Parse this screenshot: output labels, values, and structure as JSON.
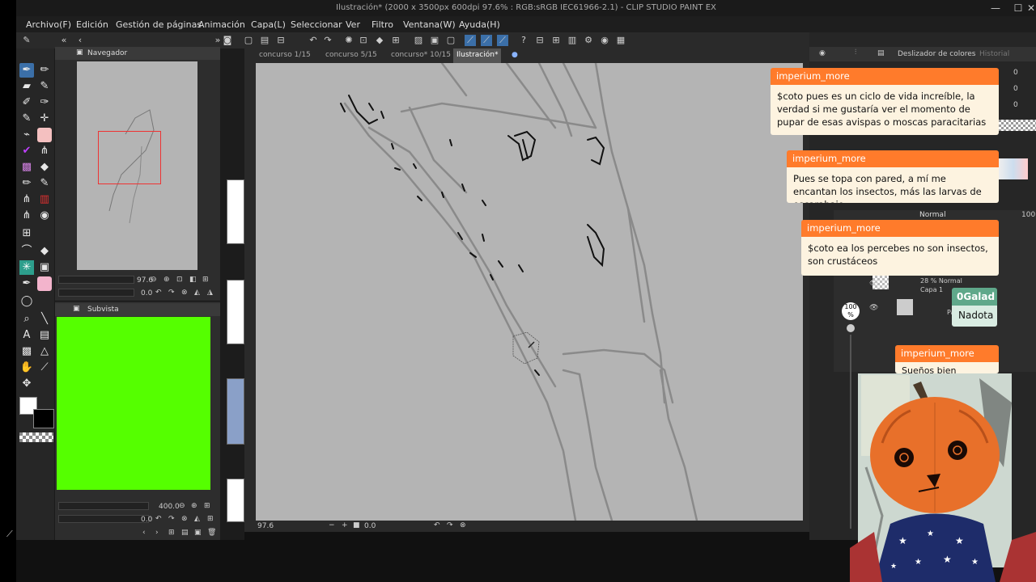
{
  "window": {
    "title": "Ilustración* (2000 x 3500px 600dpi 97.6% : RGB:sRGB IEC61966-2.1) - CLIP STUDIO PAINT EX",
    "minimize": "—",
    "maximize": "☐",
    "close": "✕"
  },
  "menu": [
    "Archivo(F)",
    "Edición",
    "Gestión de páginas",
    "Animación",
    "Capa(L)",
    "Seleccionar",
    "Ver",
    "Filtro",
    "Ventana(W)",
    "Ayuda(H)"
  ],
  "navigator": {
    "title": "Navegador",
    "zoom": "97.6",
    "rotation": "0.0"
  },
  "subview": {
    "title": "Subvista",
    "zoom": "400.0",
    "rotation": "0.0"
  },
  "tabs": [
    {
      "label": "concurso 1/15"
    },
    {
      "label": "concurso 5/15"
    },
    {
      "label": "concurso* 10/15"
    },
    {
      "label": "Ilustración*"
    }
  ],
  "canvas_status": {
    "zoom": "97.6",
    "rotation": "0.0"
  },
  "color_panel": {
    "title": "Deslizador de colores",
    "history_tab": "Historial",
    "values": [
      "0",
      "0",
      "0"
    ]
  },
  "layers": {
    "blend_mode": "Normal",
    "opacity": "100",
    "layer1_info": "28 % Normal",
    "layer1_name": "Capa 1",
    "layer2_name": "Pap"
  },
  "brush_size": {
    "value": "100",
    "unit": "%"
  },
  "chat": [
    {
      "user": "imperium_more",
      "message": "$coto pues es un ciclo de vida increíble, la verdad si me gustaría ver el momento de pupar de esas avispas o moscas paracitarias"
    },
    {
      "user": "imperium_more",
      "message": "Pues se topa con pared, a mí me encantan los insectos, más las larvas de escarabajo"
    },
    {
      "user": "imperium_more",
      "message": "$coto ea los percebes no son insectos, son crustáceos"
    },
    {
      "user": "0Galad",
      "message": "Nadota"
    },
    {
      "user": "imperium_more",
      "message": "Sueños bien especial"
    }
  ],
  "colors": {
    "chat_header": "#ff7b2b",
    "chat_body": "#fdf3e0",
    "galad_header": "#5fa88a",
    "galad_body": "#d9ece2",
    "subview_fill": "#55ff00",
    "canvas_paper": "#b4b4b4",
    "selection_red": "#e33333"
  }
}
